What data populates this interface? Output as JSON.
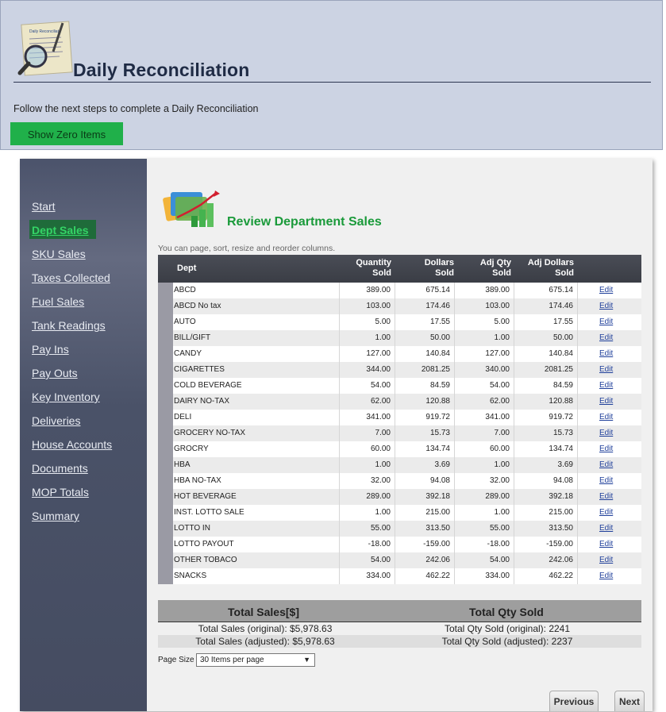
{
  "header": {
    "title": "Daily Reconciliation",
    "instructions": "Follow the next steps to complete a Daily Reconciliation",
    "zero_items_button": "Show Zero Items",
    "logo_text": "Daily Reconciliat"
  },
  "sidebar": {
    "items": [
      {
        "label": "Start"
      },
      {
        "label": "Dept Sales",
        "active": true
      },
      {
        "label": "SKU Sales"
      },
      {
        "label": "Taxes Collected"
      },
      {
        "label": "Fuel Sales"
      },
      {
        "label": "Tank Readings"
      },
      {
        "label": "Pay Ins"
      },
      {
        "label": "Pay Outs"
      },
      {
        "label": "Key Inventory"
      },
      {
        "label": "Deliveries"
      },
      {
        "label": "House Accounts"
      },
      {
        "label": "Documents"
      },
      {
        "label": "MOP Totals"
      },
      {
        "label": "Summary"
      }
    ]
  },
  "section": {
    "title": "Review Department Sales",
    "hint": "You can page, sort, resize and reorder columns."
  },
  "grid": {
    "columns": {
      "dept": "Dept",
      "qty_1": "Quantity",
      "qty_2": "Sold",
      "dol_1": "Dollars",
      "dol_2": "Sold",
      "adjq_1": "Adj Qty",
      "adjq_2": "Sold",
      "adjd_1": "Adj Dollars",
      "adjd_2": "Sold"
    },
    "edit_label": "Edit",
    "rows": [
      {
        "dept": "ABCD",
        "qty": "389.00",
        "dollars": "675.14",
        "adj_qty": "389.00",
        "adj_dollars": "675.14"
      },
      {
        "dept": "ABCD No tax",
        "qty": "103.00",
        "dollars": "174.46",
        "adj_qty": "103.00",
        "adj_dollars": "174.46"
      },
      {
        "dept": "AUTO",
        "qty": "5.00",
        "dollars": "17.55",
        "adj_qty": "5.00",
        "adj_dollars": "17.55"
      },
      {
        "dept": "BILL/GIFT",
        "qty": "1.00",
        "dollars": "50.00",
        "adj_qty": "1.00",
        "adj_dollars": "50.00"
      },
      {
        "dept": "CANDY",
        "qty": "127.00",
        "dollars": "140.84",
        "adj_qty": "127.00",
        "adj_dollars": "140.84"
      },
      {
        "dept": "CIGARETTES",
        "qty": "344.00",
        "dollars": "2081.25",
        "adj_qty": "340.00",
        "adj_dollars": "2081.25"
      },
      {
        "dept": "COLD BEVERAGE",
        "qty": "54.00",
        "dollars": "84.59",
        "adj_qty": "54.00",
        "adj_dollars": "84.59"
      },
      {
        "dept": "DAIRY NO-TAX",
        "qty": "62.00",
        "dollars": "120.88",
        "adj_qty": "62.00",
        "adj_dollars": "120.88"
      },
      {
        "dept": "DELI",
        "qty": "341.00",
        "dollars": "919.72",
        "adj_qty": "341.00",
        "adj_dollars": "919.72"
      },
      {
        "dept": "GROCERY NO-TAX",
        "qty": "7.00",
        "dollars": "15.73",
        "adj_qty": "7.00",
        "adj_dollars": "15.73"
      },
      {
        "dept": "GROCRY",
        "qty": "60.00",
        "dollars": "134.74",
        "adj_qty": "60.00",
        "adj_dollars": "134.74"
      },
      {
        "dept": "HBA",
        "qty": "1.00",
        "dollars": "3.69",
        "adj_qty": "1.00",
        "adj_dollars": "3.69"
      },
      {
        "dept": "HBA NO-TAX",
        "qty": "32.00",
        "dollars": "94.08",
        "adj_qty": "32.00",
        "adj_dollars": "94.08"
      },
      {
        "dept": "HOT BEVERAGE",
        "qty": "289.00",
        "dollars": "392.18",
        "adj_qty": "289.00",
        "adj_dollars": "392.18"
      },
      {
        "dept": "INST. LOTTO SALE",
        "qty": "1.00",
        "dollars": "215.00",
        "adj_qty": "1.00",
        "adj_dollars": "215.00"
      },
      {
        "dept": "LOTTO IN",
        "qty": "55.00",
        "dollars": "313.50",
        "adj_qty": "55.00",
        "adj_dollars": "313.50"
      },
      {
        "dept": "LOTTO PAYOUT",
        "qty": "-18.00",
        "dollars": "-159.00",
        "adj_qty": "-18.00",
        "adj_dollars": "-159.00"
      },
      {
        "dept": "OTHER TOBACO",
        "qty": "54.00",
        "dollars": "242.06",
        "adj_qty": "54.00",
        "adj_dollars": "242.06"
      },
      {
        "dept": "SNACKS",
        "qty": "334.00",
        "dollars": "462.22",
        "adj_qty": "334.00",
        "adj_dollars": "462.22"
      }
    ]
  },
  "totals": {
    "sales_header": "Total Sales[$]",
    "qty_header": "Total Qty Sold",
    "sales_original": "Total Sales (original): $5,978.63",
    "sales_adjusted": "Total Sales (adjusted): $5,978.63",
    "qty_original": "Total Qty Sold (original): 2241",
    "qty_adjusted": "Total Qty Sold (adjusted): 2237"
  },
  "pager": {
    "label": "Page Size",
    "selected": "30 Items per page"
  },
  "nav_buttons": {
    "previous": "Previous",
    "next": "Next"
  },
  "colors": {
    "accent_green": "#20b04a",
    "title_green": "#1a9a3a",
    "sidebar": "#4a5268",
    "header_bg": "#ccd3e3",
    "link_blue": "#1f3f9a"
  }
}
